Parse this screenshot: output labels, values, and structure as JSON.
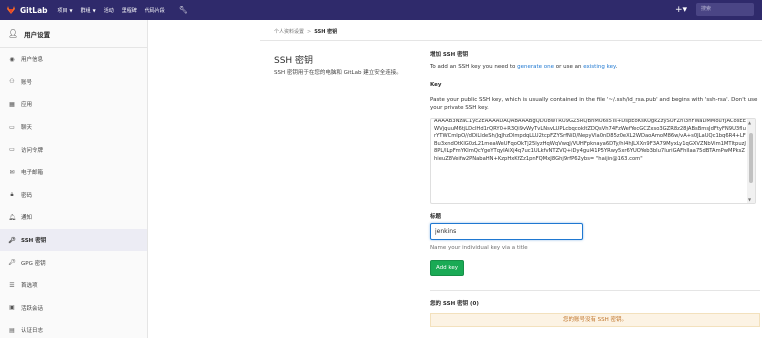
{
  "header": {
    "brand": "GitLab",
    "nav": [
      {
        "label": "项目",
        "caret": true
      },
      {
        "label": "群组",
        "caret": true
      },
      {
        "label": "活动",
        "caret": false
      },
      {
        "label": "里程碑",
        "caret": false
      },
      {
        "label": "代码片段",
        "caret": false
      }
    ],
    "search_placeholder": "搜索",
    "colors": {
      "navbar": "#2f2a6b",
      "brand_orange": "#e24329"
    }
  },
  "sidebar": {
    "title": "用户设置",
    "items": [
      {
        "label": "用户信息",
        "icon": "user-circle-icon",
        "active": false
      },
      {
        "label": "账号",
        "icon": "account-icon",
        "active": false
      },
      {
        "label": "应用",
        "icon": "applications-icon",
        "active": false
      },
      {
        "label": "聊天",
        "icon": "chat-icon",
        "active": false
      },
      {
        "label": "访问令牌",
        "icon": "token-icon",
        "active": false
      },
      {
        "label": "电子邮箱",
        "icon": "mail-icon",
        "active": false
      },
      {
        "label": "密码",
        "icon": "lock-icon",
        "active": false
      },
      {
        "label": "通知",
        "icon": "bell-icon",
        "active": false
      },
      {
        "label": "SSH 密钥",
        "icon": "key-icon",
        "active": true
      },
      {
        "label": "GPG 密钥",
        "icon": "key-icon",
        "active": false
      },
      {
        "label": "首选项",
        "icon": "preferences-icon",
        "active": false
      },
      {
        "label": "活跃会话",
        "icon": "sessions-icon",
        "active": false
      },
      {
        "label": "认证日志",
        "icon": "log-icon",
        "active": false
      }
    ]
  },
  "breadcrumb": {
    "parent": "个人资料设置",
    "separator": ">",
    "current": "SSH 密钥"
  },
  "main": {
    "title": "SSH 密钥",
    "description": "SSH 密钥用于在您的电脑和 GitLab 建立安全连接。",
    "add_title": "增加 SSH 密钥",
    "add_text_prefix": "To add an SSH key you need to ",
    "link_generate": "generate one",
    "add_text_mid": " or use an ",
    "link_existing": "existing key",
    "add_text_suffix": ".",
    "key_label": "Key",
    "key_help": "Paste your public SSH key, which is usually contained in the file '~/.ssh/id_rsa.pub' and begins with 'ssh-rsa'. Don't use your private SSH key.",
    "key_value": "AAAAB3NzaC1yc2EAAAADAQABAAABgQDU8wTRU9GZ5RQBnMU6s5Ts+DspEoKsKUgkZzySUFZhl3hFWaDMMouYJACosEEWVjquuM6tjLDclHd1rQRY0+R3Qi9vWyTvLNsvLUPLcbqcokItZDQsVh74FzWefYecGCZxso3GZR8z28jABsBmsJdFtyFN9U3fIurYTWCmIpO//dDiLldeSh/JqJhzDlmpdqLLU2tcpFZYSrfNiD/NepyVla0nD85z0eXL2WDaoAmoM86w/vA+s0JLaUQc1bq6R4+LFBu3xndOtKlG0zL21meaWeUFqoOkTj25IyzHqWqVwqJ/VUHFpknaya6DTy/hl4hJLXXn9F3A79MyxLy1qGXVZNbVim1MTltpuzJ8PL/lLpFmYKlmQcYgeYTqyIAiXj4q7uc1ULkfvNTZVQ+iDy4gul41P5YRwy5xr6YUOYeb3blu7IuriGAFhIIaa75dBTAmPwMPksZhieuZ8Veifw2PNabaHN+KzpHxKfZz1pnFQMxJ8Ghj9rfP62ybs= \"haijin@163.com\"",
    "title_label": "标题",
    "title_value": "jenkins",
    "title_help": "Name your individual key via a title",
    "add_button": "Add key",
    "keys_title": "您的 SSH 密钥 (0)",
    "no_keys_msg": "您的账号没有 SSH 密钥。"
  }
}
